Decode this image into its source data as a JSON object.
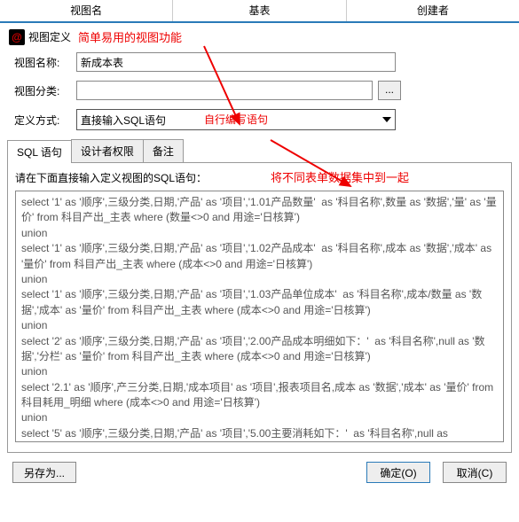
{
  "top_tabs": {
    "t1": "视图名",
    "t2": "基表",
    "t3": "创建者"
  },
  "header": {
    "title": "视图定义",
    "annotation": "简单易用的视图功能"
  },
  "form": {
    "name_label": "视图名称:",
    "name_value": "新成本表",
    "cat_label": "视图分类:",
    "cat_value": "",
    "mode_label": "定义方式:",
    "mode_value": "直接输入SQL语句",
    "mode_annotation": "自行编写语句",
    "dots": "..."
  },
  "tabs": {
    "sql": "SQL 语句",
    "perm": "设计者权限",
    "note": "备注"
  },
  "panel": {
    "prompt": "请在下面直接输入定义视图的SQL语句：",
    "prompt_annotation": "将不同表单数据集中到一起",
    "sql": "select '1' as '顺序',三级分类,日期,'产品' as '项目','1.01产品数量'  as '科目名称',数量 as '数据','量' as '量价' from 科目产出_主表 where (数量<>0 and 用途='日核算')\nunion\nselect '1' as '顺序',三级分类,日期,'产品' as '项目','1.02产品成本'  as '科目名称',成本 as '数据','成本' as '量价' from 科目产出_主表 where (成本<>0 and 用途='日核算')\nunion\nselect '1' as '顺序',三级分类,日期,'产品' as '项目','1.03产品单位成本'  as '科目名称',成本/数量 as '数据','成本' as '量价' from 科目产出_主表 where (成本<>0 and 用途='日核算')\nunion\nselect '2' as '顺序',三级分类,日期,'产品' as '项目','2.00产品成本明细如下：'  as '科目名称',null as '数据','分栏' as '量价' from 科目产出_主表 where (成本<>0 and 用途='日核算')\nunion\nselect '2.1' as '顺序',产三分类,日期,'成本项目' as '项目',报表项目名,成本 as '数据','成本' as '量价' from 科目耗用_明细 where (成本<>0 and 用途='日核算')\nunion\nselect '5' as '顺序',三级分类,日期,'产品' as '项目','5.00主要消耗如下：'  as '科目名称',null as"
  },
  "buttons": {
    "saveas": "另存为...",
    "ok": "确定(O)",
    "cancel": "取消(C)"
  }
}
